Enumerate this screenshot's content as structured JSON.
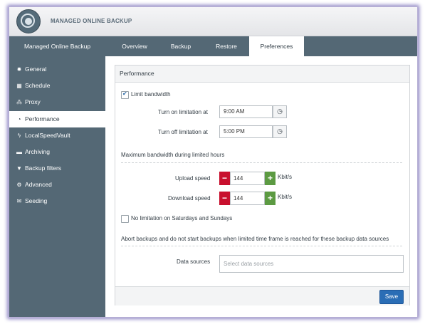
{
  "app": {
    "title": "MANAGED ONLINE BACKUP"
  },
  "nav": {
    "items": [
      {
        "label": "Managed Online Backup"
      },
      {
        "label": "Overview"
      },
      {
        "label": "Backup"
      },
      {
        "label": "Restore"
      },
      {
        "label": "Preferences"
      }
    ],
    "active": "Preferences"
  },
  "sidebar": {
    "items": [
      {
        "label": "General",
        "icon": "gear-icon"
      },
      {
        "label": "Schedule",
        "icon": "calendar-icon"
      },
      {
        "label": "Proxy",
        "icon": "network-icon"
      },
      {
        "label": "Performance",
        "icon": "speedometer-icon"
      },
      {
        "label": "LocalSpeedVault",
        "icon": "bolt-icon"
      },
      {
        "label": "Archiving",
        "icon": "folder-icon"
      },
      {
        "label": "Backup filters",
        "icon": "filter-icon"
      },
      {
        "label": "Advanced",
        "icon": "gears-icon"
      },
      {
        "label": "Seeding",
        "icon": "envelope-icon"
      }
    ],
    "active": "Performance"
  },
  "panel": {
    "title": "Performance",
    "limit_bandwidth": {
      "label": "Limit bandwidth",
      "checked": true
    },
    "turn_on": {
      "label": "Turn on limitation at",
      "value": "9:00 AM"
    },
    "turn_off": {
      "label": "Turn off limitation at",
      "value": "5:00 PM"
    },
    "max_bandwidth_heading": "Maximum bandwidth during limited hours",
    "upload": {
      "label": "Upload speed",
      "value": "144",
      "unit": "Kbit/s"
    },
    "download": {
      "label": "Download speed",
      "value": "144",
      "unit": "Kbit/s"
    },
    "no_limit_weekends": {
      "label": "No limitation on Saturdays and Sundays",
      "checked": false
    },
    "abort_heading": "Abort backups and do not start backups when limited time frame is reached for these backup data sources",
    "data_sources": {
      "label": "Data sources",
      "placeholder": "Select data sources"
    },
    "save_label": "Save"
  },
  "colors": {
    "sidebar_bg": "#546875",
    "accent": "#2a6db5",
    "minus": "#c8102e",
    "plus": "#5c9a42"
  }
}
